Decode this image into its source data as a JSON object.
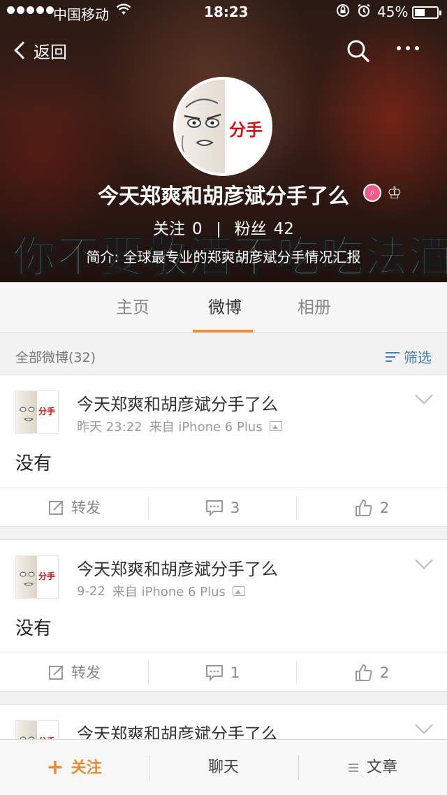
{
  "status_bar": {
    "carrier": "中国移动",
    "time": "18:23",
    "battery_text": "45%",
    "battery_level": 0.45
  },
  "nav": {
    "back_label": "返回"
  },
  "profile": {
    "avatar_tag": "分手",
    "name": "今天郑爽和胡彦斌分手了么",
    "follow_label": "关注",
    "follow_count": "0",
    "fans_label": "粉丝",
    "fans_count": "42",
    "intro": "简介: 全球最专业的郑爽胡彦斌分手情况汇报",
    "cover_caption": "你不要敬酒不吃吃法酒"
  },
  "tabs": [
    {
      "label": "主页",
      "active": false
    },
    {
      "label": "微博",
      "active": true
    },
    {
      "label": "相册",
      "active": false
    }
  ],
  "filter": {
    "count_label": "全部微博(32)",
    "screen_label": "筛选"
  },
  "posts": [
    {
      "author": "今天郑爽和胡彦斌分手了么",
      "time": "昨天 23:22",
      "source": "来自 iPhone 6 Plus",
      "body": "没有",
      "repost_label": "转发",
      "comments": "3",
      "likes": "2"
    },
    {
      "author": "今天郑爽和胡彦斌分手了么",
      "time": "9-22",
      "source": "来自 iPhone 6 Plus",
      "body": "没有",
      "repost_label": "转发",
      "comments": "1",
      "likes": "2"
    },
    {
      "author": "今天郑爽和胡彦斌分手了么"
    }
  ],
  "bottom_bar": {
    "follow_label": "关注",
    "chat_label": "聊天",
    "articles_label": "文章"
  },
  "colors": {
    "accent": "#f18d3f",
    "link": "#4a7bb5"
  }
}
